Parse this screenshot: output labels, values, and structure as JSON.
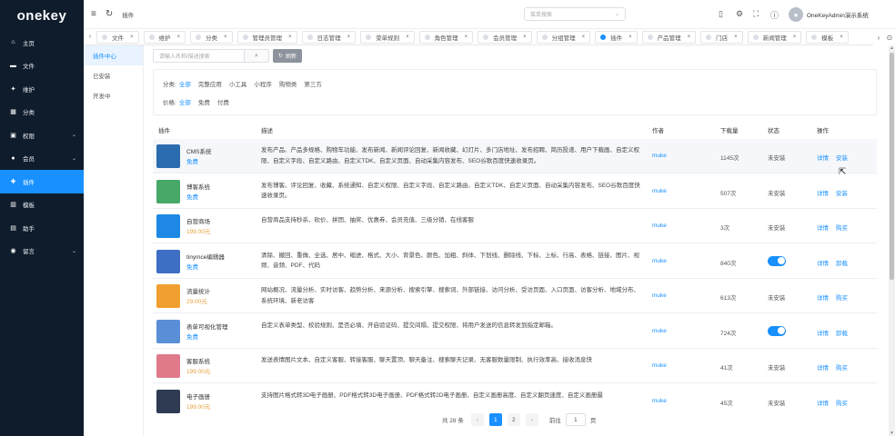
{
  "app": {
    "logo_text": "onekey",
    "logo_dot": "·"
  },
  "sidebar": {
    "items": [
      {
        "label": "主页",
        "icon": "home-icon",
        "glyph": "⌂",
        "caret": ""
      },
      {
        "label": "文件",
        "icon": "folder-icon",
        "glyph": "▬",
        "caret": ""
      },
      {
        "label": "维护",
        "icon": "wrench-icon",
        "glyph": "✦",
        "caret": ""
      },
      {
        "label": "分类",
        "icon": "grid-icon",
        "glyph": "▦",
        "caret": ""
      },
      {
        "label": "权限",
        "icon": "lock-icon",
        "glyph": "▣",
        "caret": "⌄"
      },
      {
        "label": "会员",
        "icon": "user-icon",
        "glyph": "●",
        "caret": "⌄"
      },
      {
        "label": "插件",
        "icon": "plugin-icon",
        "glyph": "✚",
        "caret": ""
      },
      {
        "label": "模板",
        "icon": "template-icon",
        "glyph": "▥",
        "caret": ""
      },
      {
        "label": "助手",
        "icon": "assistant-icon",
        "glyph": "▤",
        "caret": ""
      },
      {
        "label": "留言",
        "icon": "message-icon",
        "glyph": "◉",
        "caret": "⌄"
      }
    ]
  },
  "header": {
    "menu_icon": "≡",
    "refresh_icon": "↻",
    "breadcrumb": "插件",
    "menu_search_placeholder": "菜单搜索",
    "menu_search_caret": "⌄",
    "icons": [
      {
        "name": "mobile-icon",
        "glyph": "▯"
      },
      {
        "name": "settings-icon",
        "glyph": "⚙"
      },
      {
        "name": "fullscreen-icon",
        "glyph": "⛶"
      },
      {
        "name": "info-icon",
        "glyph": "ⓘ"
      }
    ],
    "user_name": "OneKeyAdmin演示系统",
    "user_caret": "⌄"
  },
  "tabs": {
    "left_arrow": "‹",
    "items": [
      {
        "label": "文件",
        "active": false
      },
      {
        "label": "维护",
        "active": false
      },
      {
        "label": "分类",
        "active": false
      },
      {
        "label": "管理员管理",
        "active": false
      },
      {
        "label": "日志管理",
        "active": false
      },
      {
        "label": "菜单规则",
        "active": false
      },
      {
        "label": "角色管理",
        "active": false
      },
      {
        "label": "会员管理",
        "active": false
      },
      {
        "label": "分组管理",
        "active": false
      },
      {
        "label": "插件",
        "active": true
      },
      {
        "label": "产品管理",
        "active": false
      },
      {
        "label": "门店",
        "active": false
      },
      {
        "label": "新闻管理",
        "active": false
      },
      {
        "label": "模板",
        "active": false
      }
    ],
    "close_glyph": "×",
    "right_arrow": "›",
    "more_icon": "⊙"
  },
  "subnav": {
    "items": [
      {
        "label": "插件中心",
        "active": true
      },
      {
        "label": "已安装",
        "active": false
      },
      {
        "label": "开发中",
        "active": false
      }
    ]
  },
  "toolbar": {
    "search_placeholder": "请输入名称/描述搜索",
    "search_icon": "⌕",
    "refresh_label": "刷新",
    "refresh_icon": "↻"
  },
  "filters": {
    "category_label": "分类:",
    "categories": [
      "全部",
      "完整应用",
      "小工具",
      "小程序",
      "购物类",
      "第三方"
    ],
    "category_selected": 0,
    "price_label": "价格:",
    "prices": [
      "全部",
      "免费",
      "付费"
    ],
    "price_selected": 0
  },
  "table": {
    "headers": {
      "plugin": "插件",
      "desc": "描述",
      "author": "作者",
      "downloads": "下载量",
      "status": "状态",
      "actions": "操作"
    },
    "rows": [
      {
        "name": "CMS系统",
        "price": "免费",
        "paid": false,
        "desc": "发布产品、产品多规格、购物车功能、发布新闻、新闻评论回复、新闻收藏、幻灯片、多门店地址、发布招聘、简历投递、用户下载画、自定义权限、自定义字段、自定义路由、自定义TDK、自定义页面、自动采集内容发布、SEO谷歌百度快速收录页。",
        "author": "muke",
        "downloads": "1145次",
        "status": "未安装",
        "switch": false,
        "action1": "详情",
        "action2": "安装",
        "thumb": "#2b6cb0"
      },
      {
        "name": "博客系统",
        "price": "免费",
        "paid": false,
        "desc": "发布博客、评论回复、收藏、系统通知、自定义权限、自定义字段、自定义路由、自定义TDK、自定义页面、自动采集内容发布、SEO谷歌百度快速收录页。",
        "author": "muke",
        "downloads": "507次",
        "status": "未安装",
        "switch": false,
        "action1": "详情",
        "action2": "安装",
        "thumb": "#48a868"
      },
      {
        "name": "自营商场",
        "price": "199.00元",
        "paid": true,
        "desc": "自营商品支持秒杀、砍价、拼团、抽奖、优惠券、会员充值、三级分销、在线客服",
        "author": "muke",
        "downloads": "3次",
        "status": "未安装",
        "switch": false,
        "action1": "详情",
        "action2": "购买",
        "thumb": "#1e88e5"
      },
      {
        "name": "tinymce编辑器",
        "price": "免费",
        "paid": false,
        "desc": "清除、撤回、重做、全选、居中、缩进、格式、大小、背景色、颜色、加粗、斜体、下划线、删除线、下标、上标、行高、表格、链接、图片、视频、音频、PDF、代码",
        "author": "muke",
        "downloads": "840次",
        "status": "",
        "switch": true,
        "action1": "详情",
        "action2": "卸载",
        "thumb": "#3f6fc5"
      },
      {
        "name": "流量统计",
        "price": "29.00元",
        "paid": true,
        "desc": "网站概况、流量分析、实时访客、趋势分析、来源分析、搜索引擎、搜索词、外部链接、访问分析、受访页面、入口页面、访客分析、地域分布、系统环境、新老访客",
        "author": "muke",
        "downloads": "613次",
        "status": "未安装",
        "switch": false,
        "action1": "详情",
        "action2": "购买",
        "thumb": "#f0a030"
      },
      {
        "name": "表单可视化管理",
        "price": "免费",
        "paid": false,
        "desc": "自定义表单类型、校验规则、是否必填、开启验证码、提交间隔、提交权限、将用户发送的信息转发到指定邮箱。",
        "author": "muke",
        "downloads": "724次",
        "status": "",
        "switch": true,
        "action1": "详情",
        "action2": "卸载",
        "thumb": "#5a8fd8"
      },
      {
        "name": "客服系统",
        "price": "199.00元",
        "paid": true,
        "desc": "发送表情图片文本、自定义客服、转接客服、聊天置顶、聊天备注、搜索聊天记录、无客服数量限制、执行效率高、接收消息快",
        "author": "muke",
        "downloads": "41次",
        "status": "未安装",
        "switch": false,
        "action1": "详情",
        "action2": "购买",
        "thumb": "#e07a8a"
      },
      {
        "name": "电子画册",
        "price": "199.00元",
        "paid": true,
        "desc": "支持图片格式转3D电子画册、PDF格式转3D电子画册、PDF格式转2D电子画册、自定义画册高度、自定义翻页速度、自定义画册最",
        "author": "muke",
        "downloads": "45次",
        "status": "未安装",
        "switch": false,
        "action1": "详情",
        "action2": "购买",
        "thumb": "#2f3b52"
      }
    ]
  },
  "pagination": {
    "total": "共 28 条",
    "prev": "‹",
    "pages": [
      "1",
      "2"
    ],
    "current": 0,
    "next": "›",
    "goto_label": "前往",
    "goto_value": "1",
    "goto_suffix": "页"
  },
  "scrollbar": {
    "up": "▲",
    "down": "▼"
  },
  "cursor": "⇱"
}
